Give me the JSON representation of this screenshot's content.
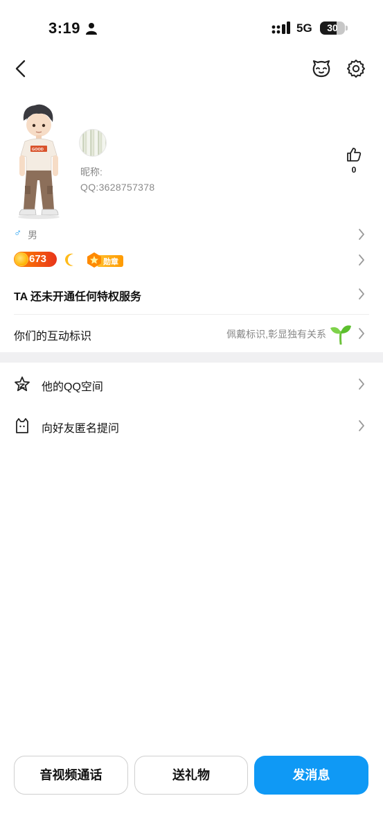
{
  "status_bar": {
    "time": "3:19",
    "network": "5G",
    "battery": "30",
    "battery_level_percent": 30
  },
  "nav": {
    "back_icon": "chevron-left-icon",
    "pet_icon": "pet-face-icon",
    "settings_icon": "gear-icon"
  },
  "profile": {
    "nickname_label": "昵称:",
    "qq_label": "QQ:3628757378",
    "likes": "0",
    "gender": "男"
  },
  "badges": {
    "level_number": "673",
    "medal_label": "勋章"
  },
  "rows": {
    "privilege": "TA 还未开通任何特权服务",
    "interaction_title": "你们的互动标识",
    "interaction_hint": "佩戴标识,彰显独有关系"
  },
  "menu": [
    {
      "label": "他的QQ空间",
      "icon": "qzone-star-icon"
    },
    {
      "label": "向好友匿名提问",
      "icon": "anonymous-question-icon"
    }
  ],
  "actions": {
    "call": "音视频通话",
    "gift": "送礼物",
    "message": "发消息"
  },
  "colors": {
    "accent": "#0f99f5",
    "gender": "#1a9cf0",
    "level_badge": "#e8341a",
    "section_gap": "#f0f0f2"
  }
}
